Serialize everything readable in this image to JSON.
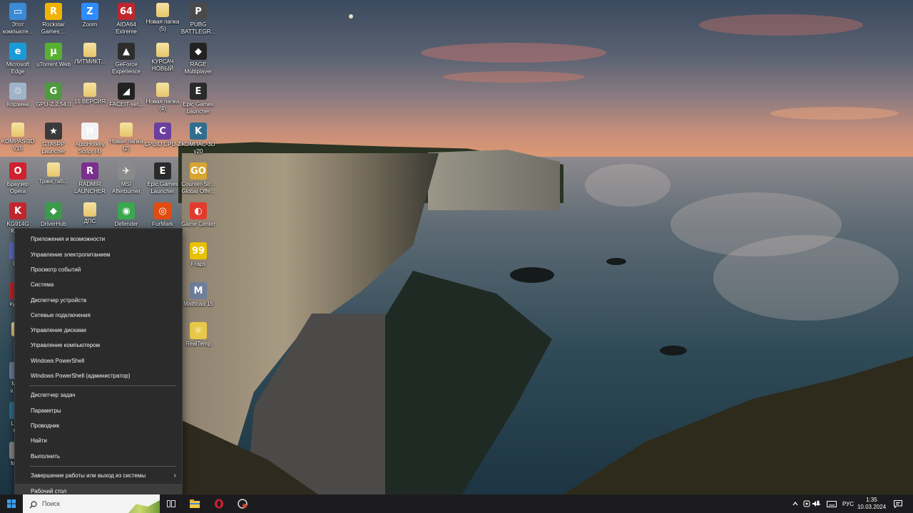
{
  "desktop": {
    "icons": [
      {
        "label": "Этот\nкомпьюте...",
        "icon": "this-pc-icon",
        "color": "#3a8ad6",
        "glyph": "▭"
      },
      {
        "label": "Rockstar\nGames ...",
        "icon": "rockstar-games-icon",
        "color": "#f0b400",
        "glyph": "R"
      },
      {
        "label": "Zoom",
        "icon": "zoom-icon",
        "color": "#2d8cff",
        "glyph": "Z"
      },
      {
        "label": "AIDA64\nExtreme",
        "icon": "aida64-icon",
        "color": "#c0262d",
        "glyph": "64"
      },
      {
        "label": "Новая папка\n(5)",
        "icon": "folder-icon",
        "color": "#e9cf7a",
        "glyph": ""
      },
      {
        "label": "PUBG\nBATTLEGR...",
        "icon": "pubg-icon",
        "color": "#4a4a4a",
        "glyph": "P"
      },
      {
        "label": "Microsoft\nEdge",
        "icon": "edge-icon",
        "color": "#1a9bd7",
        "glyph": "e"
      },
      {
        "label": "uTorrent Web",
        "icon": "utorrent-icon",
        "color": "#58b030",
        "glyph": "µ"
      },
      {
        "label": "ЛИТМИКТ...",
        "icon": "folder-icon",
        "color": "#e9cf7a",
        "glyph": ""
      },
      {
        "label": "GeForce\nExperience",
        "icon": "geforce-icon",
        "color": "#2d2d2d",
        "glyph": "▲"
      },
      {
        "label": "КУРСАЧ\nНОВЫЙ",
        "icon": "folder-icon",
        "color": "#e9cf7a",
        "glyph": ""
      },
      {
        "label": "RAGE\nMultiplayer",
        "icon": "rage-mp-icon",
        "color": "#222",
        "glyph": "◆"
      },
      {
        "label": "Корзина",
        "icon": "recycle-bin-icon",
        "color": "#9fb4c8",
        "glyph": "♲"
      },
      {
        "label": "GPU-Z.2.54.0",
        "icon": "gpuz-icon",
        "color": "#4e9a3e",
        "glyph": "G"
      },
      {
        "label": "15 ВЕРСИЯ",
        "icon": "folder-icon",
        "color": "#e9cf7a",
        "glyph": ""
      },
      {
        "label": "FACEIT-set...",
        "icon": "faceit-icon",
        "color": "#222",
        "glyph": "◢"
      },
      {
        "label": "Новая папка\n(4)",
        "icon": "folder-icon",
        "color": "#e9cf7a",
        "glyph": ""
      },
      {
        "label": "Epic Games\nLauncher",
        "icon": "epic-games-icon",
        "color": "#2a2a2a",
        "glyph": "E"
      },
      {
        "label": "KOMPAS-3D\nV15",
        "icon": "folder-icon",
        "color": "#e9cf7a",
        "glyph": ""
      },
      {
        "label": "GTA5RP\nLauncher",
        "icon": "gta5rp-icon",
        "color": "#3a3a3a",
        "glyph": "★"
      },
      {
        "label": "AutoHotkey\nScript (4)",
        "icon": "autohotkey-icon",
        "color": "#f2f2f2",
        "glyph": "H"
      },
      {
        "label": "Новая папка\n(2)",
        "icon": "folder-icon",
        "color": "#e9cf7a",
        "glyph": ""
      },
      {
        "label": "CPUID CPU-Z",
        "icon": "cpuz-icon",
        "color": "#6b3fa0",
        "glyph": "C"
      },
      {
        "label": "КОМПАС-3D\nv20",
        "icon": "kompas-icon",
        "color": "#2f6e8e",
        "glyph": "K"
      },
      {
        "label": "Браузер\nOpera",
        "icon": "opera-icon",
        "color": "#d1202f",
        "glyph": "O"
      },
      {
        "label": "Транг,таб...",
        "icon": "folder-icon",
        "color": "#e9cf7a",
        "glyph": ""
      },
      {
        "label": "RADMIR\nLAUNCHER",
        "icon": "radmir-icon",
        "color": "#7b2f8e",
        "glyph": "R"
      },
      {
        "label": "MSI\nAfterburner",
        "icon": "msi-afterburner-icon",
        "color": "#8a8a8a",
        "glyph": "✈"
      },
      {
        "label": "Epic Games\nLauncher",
        "icon": "epic-games-icon",
        "color": "#2a2a2a",
        "glyph": "E"
      },
      {
        "label": "Counter-Str...\nGlobal Offe...",
        "icon": "csgo-icon",
        "color": "#d8a531",
        "glyph": "GO"
      },
      {
        "label": "KG914G\nKey...",
        "icon": "kg914g-icon",
        "color": "#c0262d",
        "glyph": "K"
      },
      {
        "label": "DriverHub",
        "icon": "driverhub-icon",
        "color": "#3c9b4b",
        "glyph": "◆"
      },
      {
        "label": "ДПС",
        "icon": "folder-icon",
        "color": "#e9cf7a",
        "glyph": ""
      },
      {
        "label": "Defender",
        "icon": "defender-icon",
        "color": "#3aa850",
        "glyph": "◉"
      },
      {
        "label": "FurMark",
        "icon": "furmark-icon",
        "color": "#e04c12",
        "glyph": "◎"
      },
      {
        "label": "Game Center",
        "icon": "game-center-icon",
        "color": "#e23b2e",
        "glyph": "◐"
      },
      {
        "label": "Fraps",
        "icon": "fraps-icon",
        "color": "#e8c200",
        "glyph": "99"
      },
      {
        "label": "Mathcad 15",
        "icon": "mathcad-icon",
        "color": "#6d7e9a",
        "glyph": "M"
      },
      {
        "label": "RealTemp",
        "icon": "realtemp-icon",
        "color": "#e7c84a",
        "glyph": "☼"
      },
      {
        "label": "Di...",
        "icon": "partial-app-icon",
        "color": "#5a6cc8",
        "glyph": ""
      },
      {
        "label": "курс...",
        "icon": "partial-app-icon",
        "color": "#c0262d",
        "glyph": ""
      },
      {
        "label": "",
        "icon": "folder-icon",
        "color": "#e9cf7a",
        "glyph": ""
      },
      {
        "label": "Ma...\nv.15...",
        "icon": "partial-app-icon",
        "color": "#6d7e9a",
        "glyph": ""
      },
      {
        "label": "Lesta\nG...",
        "icon": "partial-app-icon",
        "color": "#2f6e8e",
        "glyph": ""
      },
      {
        "label": "MM...",
        "icon": "partial-app-icon",
        "color": "#8a8a8a",
        "glyph": ""
      }
    ]
  },
  "context_menu": {
    "items": [
      "Приложения и возможности",
      "Управление электропитанием",
      "Просмотр событий",
      "Система",
      "Диспетчер устройств",
      "Сетевые подключения",
      "Управление дисками",
      "Управление компьютером",
      "Windows PowerShell",
      "Windows PowerShell (администратор)",
      "Диспетчер задач",
      "Параметры",
      "Проводник",
      "Найти",
      "Выполнить",
      "Завершение работы или выход из системы",
      "Рабочий стол"
    ]
  },
  "taskbar": {
    "search_placeholder": "Поиск",
    "language": "РУС",
    "time": "1:35",
    "date": "10.03.2024",
    "pinned": [
      {
        "icon": "task-view-icon"
      },
      {
        "icon": "file-explorer-icon"
      },
      {
        "icon": "opera-icon"
      },
      {
        "icon": "game-center-icon"
      }
    ]
  }
}
